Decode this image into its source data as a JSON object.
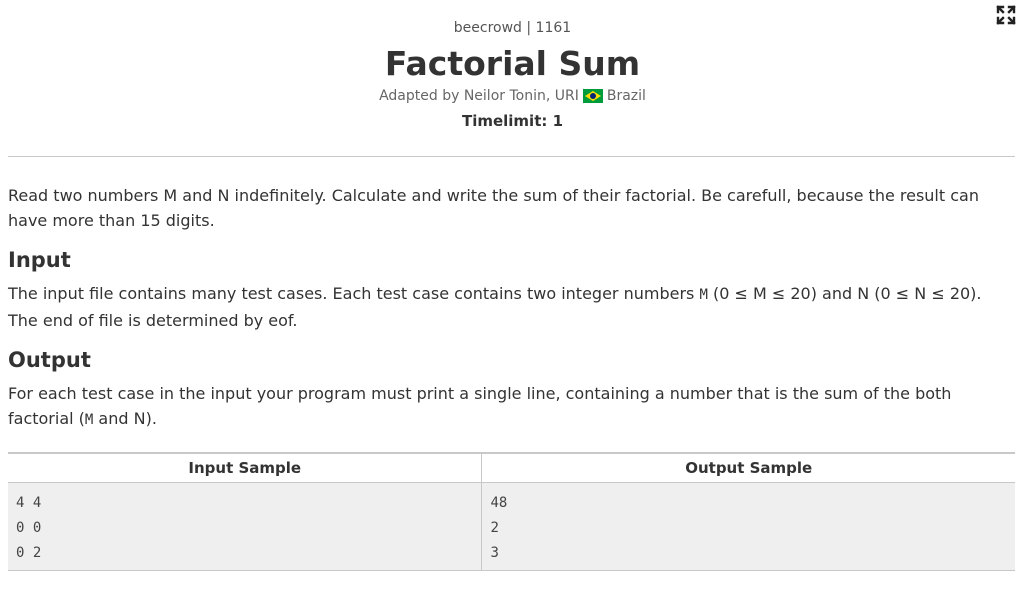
{
  "header": {
    "source": "beecrowd | 1161",
    "title": "Factorial Sum",
    "author": "Adapted by Neilor Tonin, URI",
    "country": "Brazil",
    "timelimit": "Timelimit: 1"
  },
  "description": {
    "text": "Read two numbers M and N indefinitely. Calculate and write the sum of their factorial. Be carefull, because the result can have more than 15 digits."
  },
  "input": {
    "heading": "Input",
    "text_before": "The input file contains many test cases. Each test case contains two integer numbers ",
    "var_m": "M",
    "mid1": " (0 ≤ M ≤ 20) and N (0 ≤ N ≤ 20). The end of file is determined by eof."
  },
  "output": {
    "heading": "Output",
    "text_before": "For each test case in the input your program must print a single line, containing a number that is the sum of the both factorial (",
    "var_m": "M",
    "text_after": " and N)."
  },
  "samples": {
    "input_header": "Input Sample",
    "output_header": "Output Sample",
    "input_lines": [
      "4 4",
      "0 0",
      "0 2"
    ],
    "output_lines": [
      "48",
      "2",
      "3"
    ]
  },
  "icons": {
    "expand": "expand-icon",
    "flag": "brazil-flag-icon"
  },
  "colors": {
    "text": "#333333",
    "sample_bg": "#efefef",
    "border": "#c8c8c8",
    "flag_green": "#009b3a",
    "flag_yellow": "#fedf00",
    "flag_blue": "#002776"
  }
}
